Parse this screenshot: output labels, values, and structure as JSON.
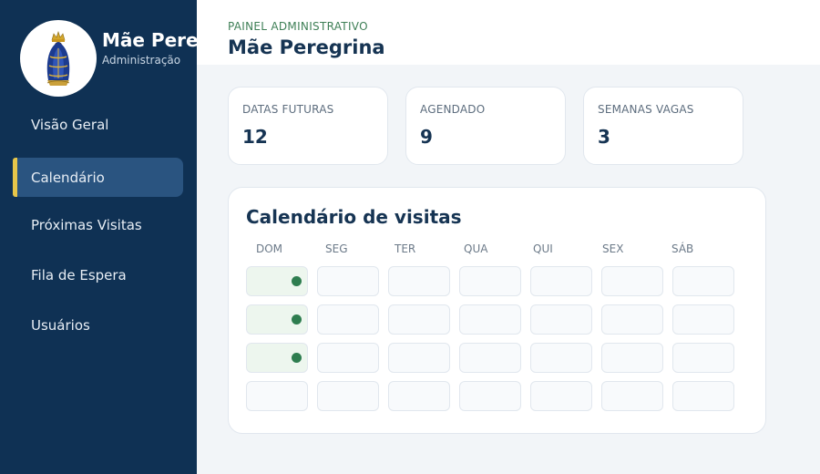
{
  "sidebar": {
    "brand_name": "Mãe Peregrina",
    "brand_subtitle": "Administração",
    "logo_icon": "our-lady-aparecida-icon",
    "items": [
      {
        "label": "Visão Geral",
        "active": false
      },
      {
        "label": "Calendário",
        "active": true
      },
      {
        "label": "Próximas Visitas",
        "active": false
      },
      {
        "label": "Fila de Espera",
        "active": false
      },
      {
        "label": "Usuários",
        "active": false
      }
    ]
  },
  "header": {
    "eyebrow": "PAINEL ADMINISTRATIVO",
    "title": "Mãe Peregrina"
  },
  "stats": [
    {
      "label": "DATAS FUTURAS",
      "value": "12"
    },
    {
      "label": "AGENDADO",
      "value": "9"
    },
    {
      "label": "SEMANAS VAGAS",
      "value": "3"
    }
  ],
  "calendar": {
    "title": "Calendário de visitas",
    "weekdays": [
      "DOM",
      "SEG",
      "TER",
      "QUA",
      "QUI",
      "SEX",
      "SÁB"
    ],
    "weeks": [
      [
        true,
        false,
        false,
        false,
        false,
        false,
        false
      ],
      [
        true,
        false,
        false,
        false,
        false,
        false,
        false
      ],
      [
        true,
        false,
        false,
        false,
        false,
        false,
        false
      ],
      [
        false,
        false,
        false,
        false,
        false,
        false,
        false
      ]
    ]
  },
  "colors": {
    "sidebar_bg": "#0f3154",
    "active_item_bg": "#2a5480",
    "active_accent": "#e7c64a",
    "booked_dot": "#2e7d4f",
    "booked_cell_bg": "#edf6ee",
    "title_text": "#163453",
    "eyebrow_text": "#3e7f56"
  }
}
